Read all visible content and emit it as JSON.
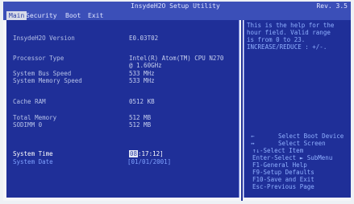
{
  "titlebar": {
    "title": "InsydeH2O Setup Utility",
    "rev": "Rev. 3.5"
  },
  "menu": [
    {
      "label": "Main",
      "active": true
    },
    {
      "label": "Security",
      "active": false
    },
    {
      "label": "Boot",
      "active": false
    },
    {
      "label": "Exit",
      "active": false
    }
  ],
  "info": [
    {
      "label": "InsydeH2O Version",
      "value": "E0.03T02"
    },
    {
      "label": "Processor Type",
      "value": "Intel(R) Atom(TM) CPU N270",
      "value2": "@ 1.60GHz"
    },
    {
      "label": "System Bus Speed",
      "value": "533 MHz"
    },
    {
      "label": "System Memory Speed",
      "value": "533 MHz"
    },
    {
      "label": "Cache RAM",
      "value": "0512 KB"
    },
    {
      "label": "Total Memory",
      "value": "512 MB"
    },
    {
      "label": "SODIMM 0",
      "value": "512 MB"
    }
  ],
  "system_time": {
    "label": "System Time",
    "hour": "08",
    "rest": ":17:12]"
  },
  "system_date": {
    "label": "System Date",
    "value": "[01/01/2001]"
  },
  "help": {
    "lines": [
      "This is the help for the",
      "hour field. Valid range",
      "is from 0 to 23.",
      "INCREASE/REDUCE : +/-."
    ]
  },
  "keys": [
    {
      "k": "←",
      "d": "Select Boot Device"
    },
    {
      "k": "↔",
      "d": "Select Screen"
    },
    {
      "k": "",
      "d": "↑↓-Select Item"
    },
    {
      "k": "",
      "d": "Enter-Select ► SubMenu"
    },
    {
      "k": "",
      "d": "F1-General Help"
    },
    {
      "k": "",
      "d": "F9-Setup Defaults"
    },
    {
      "k": "",
      "d": "F10-Save and Exit"
    },
    {
      "k": "",
      "d": "Esc-Previous Page"
    }
  ]
}
